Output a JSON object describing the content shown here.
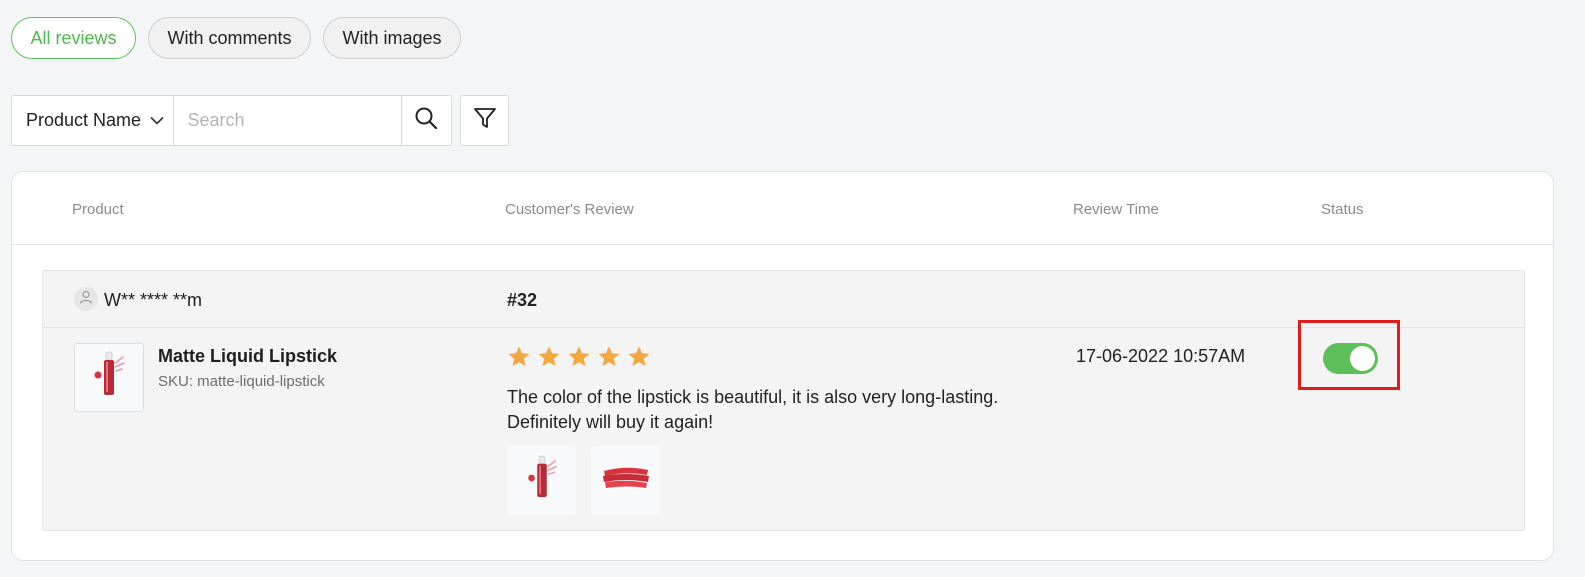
{
  "tabs": [
    {
      "label": "All reviews",
      "active": true
    },
    {
      "label": "With comments",
      "active": false
    },
    {
      "label": "With images",
      "active": false
    }
  ],
  "search": {
    "field_selected": "Product Name",
    "placeholder": "Search"
  },
  "table": {
    "headers": {
      "product": "Product",
      "review": "Customer's Review",
      "time": "Review Time",
      "status": "Status"
    }
  },
  "review": {
    "reviewer": "W** **** **m",
    "id": "#32",
    "product_name": "Matte Liquid Lipstick",
    "sku": "SKU: matte-liquid-lipstick",
    "rating": 5,
    "text": "The color of the lipstick is beautiful, it is also very long-lasting. Definitely will buy it again!",
    "time": "17-06-2022 10:57AM",
    "status_on": true,
    "images": [
      "lipstick-tube-image",
      "lipstick-swatch-image"
    ]
  },
  "colors": {
    "accent": "#5cc05a",
    "star": "#f5a741",
    "highlight": "#e41b1b"
  }
}
